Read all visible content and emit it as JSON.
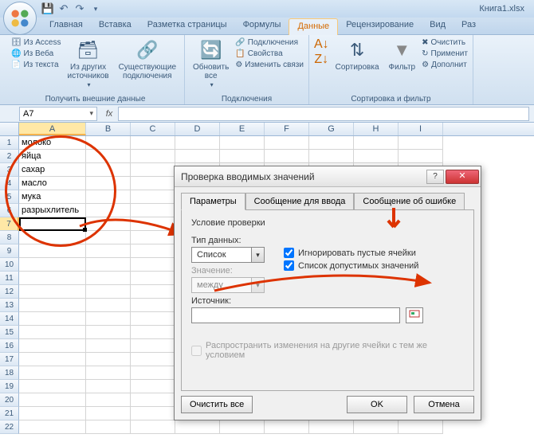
{
  "window": {
    "title": "Книга1.xlsx"
  },
  "tabs": {
    "home": "Главная",
    "insert": "Вставка",
    "layout": "Разметка страницы",
    "formulas": "Формулы",
    "data": "Данные",
    "review": "Рецензирование",
    "view": "Вид",
    "dev": "Раз"
  },
  "ribbon": {
    "ext": {
      "access": "Из Access",
      "web": "Из Веба",
      "text": "Из текста",
      "other": "Из других\nисточников",
      "existing": "Существующие\nподключения",
      "label": "Получить внешние данные"
    },
    "conn": {
      "refresh": "Обновить\nвсе",
      "connections": "Подключения",
      "properties": "Свойства",
      "edit_links": "Изменить связи",
      "label": "Подключения"
    },
    "sort": {
      "sort": "Сортировка",
      "filter": "Фильтр",
      "clear": "Очистить",
      "reapply": "Применит",
      "advanced": "Дополнит",
      "label": "Сортировка и фильтр"
    }
  },
  "namebox": {
    "value": "A7"
  },
  "columns": [
    "A",
    "B",
    "C",
    "D",
    "E",
    "F",
    "G",
    "H",
    "I"
  ],
  "rows_data": {
    "1": "молоко",
    "2": "яйца",
    "3": "сахар",
    "4": "масло",
    "5": "мука",
    "6": "разрыхлитель"
  },
  "dialog": {
    "title": "Проверка вводимых значений",
    "tabs": {
      "params": "Параметры",
      "input_msg": "Сообщение для ввода",
      "error_msg": "Сообщение об ошибке"
    },
    "legend": "Условие проверки",
    "type_label": "Тип данных:",
    "type_value": "Список",
    "value_label": "Значение:",
    "value_value": "между",
    "ignore_blank": "Игнорировать пустые ячейки",
    "dropdown_list": "Список допустимых значений",
    "source_label": "Источник:",
    "propagate": "Распространить изменения на другие ячейки с тем же условием",
    "clear_all": "Очистить все",
    "ok": "OK",
    "cancel": "Отмена"
  }
}
